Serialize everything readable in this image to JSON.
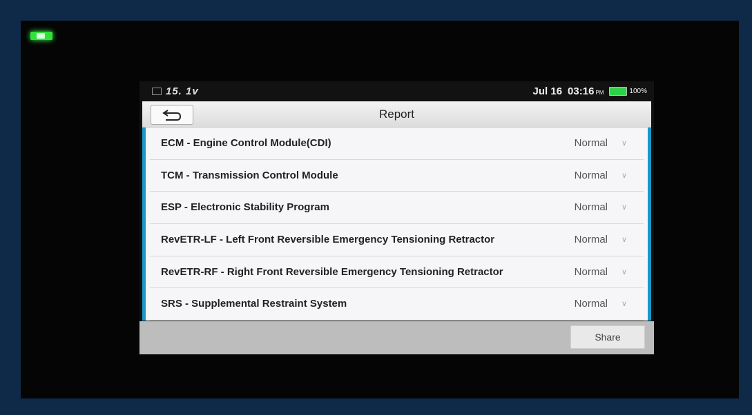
{
  "status_bar": {
    "voltage": "15. 1v",
    "date": "Jul 16",
    "time": "03:16",
    "ampm": "PM",
    "battery": "100%",
    "battery_color": "#2ed24a"
  },
  "header": {
    "back_icon": "back-arrow-icon",
    "title": "Report"
  },
  "modules": [
    {
      "label": "ECM - Engine Control Module(CDI)",
      "status": "Normal"
    },
    {
      "label": "TCM - Transmission Control Module",
      "status": "Normal"
    },
    {
      "label": "ESP - Electronic Stability Program",
      "status": "Normal"
    },
    {
      "label": "RevETR-LF - Left Front Reversible Emergency Tensioning Retractor",
      "status": "Normal"
    },
    {
      "label": "RevETR-RF - Right Front Reversible Emergency Tensioning Retractor",
      "status": "Normal"
    },
    {
      "label": "SRS - Supplemental Restraint System",
      "status": "Normal"
    }
  ],
  "footer": {
    "share_label": "Share"
  },
  "colors": {
    "accent": "#1c97c7",
    "device_led": "#2ee23a"
  }
}
